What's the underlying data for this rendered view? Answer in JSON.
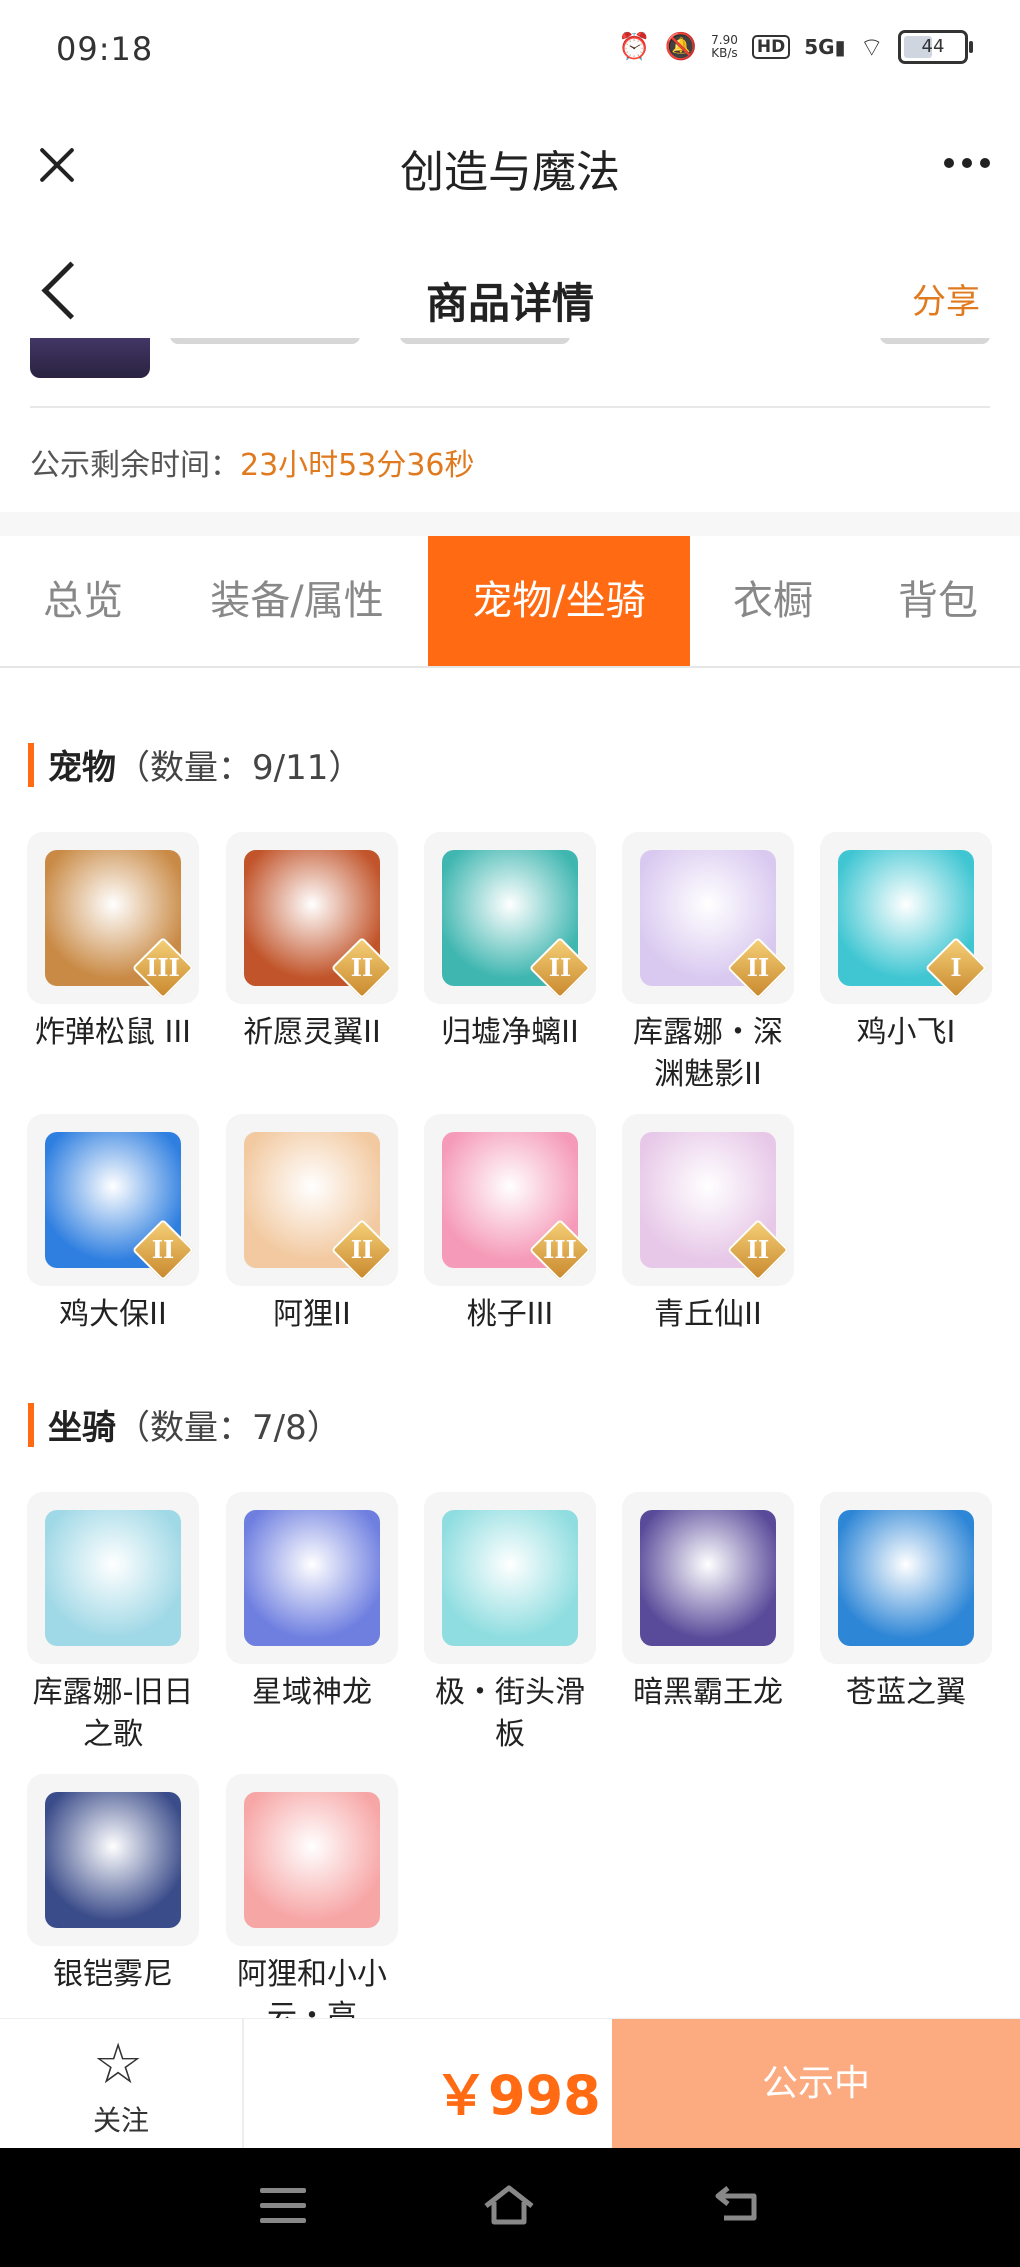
{
  "status_bar": {
    "time": "09:18",
    "net_speed": "7.90\nKB/s",
    "hd": "HD",
    "signal": "5G",
    "battery": "44"
  },
  "app_bar": {
    "title": "创造与魔法"
  },
  "page_bar": {
    "title": "商品详情",
    "share_label": "分享"
  },
  "publicity": {
    "label": "公示剩余时间：",
    "value": "23小时53分36秒"
  },
  "tabs": [
    {
      "label": "总览",
      "active": false
    },
    {
      "label": "装备/属性",
      "active": false
    },
    {
      "label": "宠物/坐骑",
      "active": true
    },
    {
      "label": "衣橱",
      "active": false
    },
    {
      "label": "背包",
      "active": false
    }
  ],
  "pets": {
    "title": "宠物",
    "count": "（数量：9/11）",
    "items": [
      {
        "name": "炸弹松鼠 III",
        "tier": "III",
        "color": "#c98a45"
      },
      {
        "name": "祈愿灵翼II",
        "tier": "II",
        "color": "#c1542a"
      },
      {
        "name": "归墟净螭II",
        "tier": "II",
        "color": "#3fb6b0"
      },
      {
        "name": "库露娜・深渊魅影II",
        "tier": "II",
        "color": "#d9c9f0"
      },
      {
        "name": "鸡小飞I",
        "tier": "I",
        "color": "#3fc6d2"
      },
      {
        "name": "鸡大保II",
        "tier": "II",
        "color": "#2f7fe0"
      },
      {
        "name": "阿狸II",
        "tier": "II",
        "color": "#f2c9a0"
      },
      {
        "name": "桃子III",
        "tier": "III",
        "color": "#f59ab8"
      },
      {
        "name": "青丘仙II",
        "tier": "II",
        "color": "#e7c8e8"
      }
    ]
  },
  "mounts": {
    "title": "坐骑",
    "count": "（数量：7/8）",
    "items": [
      {
        "name": "库露娜-旧日之歌",
        "color": "#9fd8e6"
      },
      {
        "name": "星域神龙",
        "color": "#6f7fe0"
      },
      {
        "name": "极・街头滑板",
        "color": "#8fdde0"
      },
      {
        "name": "暗黑霸王龙",
        "color": "#5a4b9a"
      },
      {
        "name": "苍蓝之翼",
        "color": "#2e86d6"
      },
      {
        "name": "银铠雾尼",
        "color": "#3b4c8a"
      },
      {
        "name": "阿狸和小小云・高",
        "color": "#f7a6a6"
      }
    ]
  },
  "action_bar": {
    "follow_label": "关注",
    "price": "￥998",
    "status_label": "公示中"
  },
  "icons": {
    "close": "close-icon",
    "more": "more-icon",
    "back": "back-arrow-icon",
    "star": "star-icon",
    "menu": "menu-icon",
    "home": "home-icon",
    "nav_back": "nav-back-icon"
  },
  "colors": {
    "accent": "#ff6a12",
    "share": "#e07a1f",
    "status_button": "#fcaa80"
  }
}
